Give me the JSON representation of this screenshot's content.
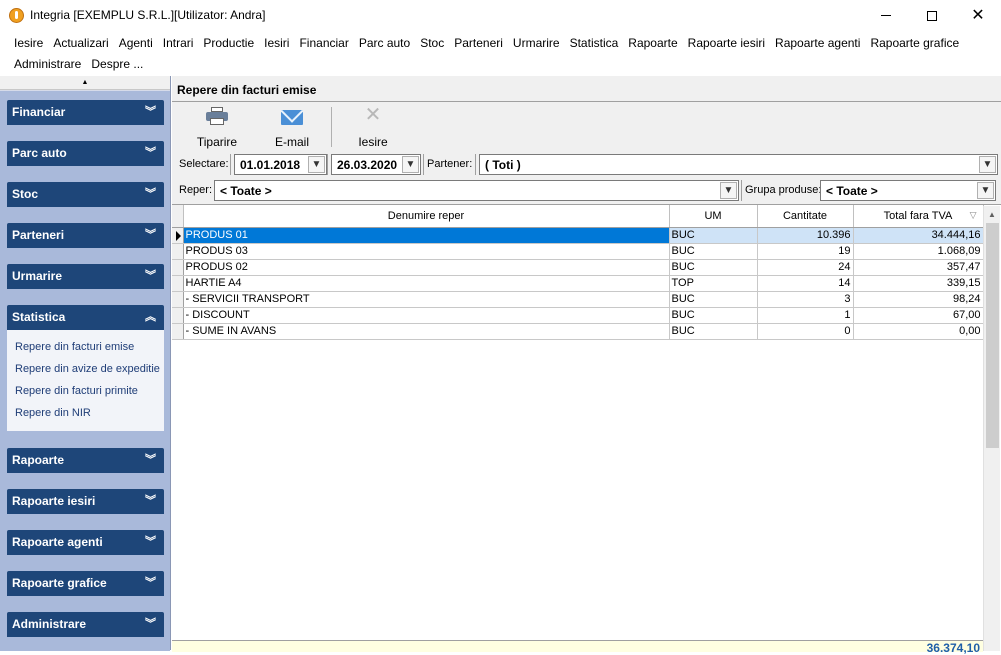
{
  "window": {
    "title": "Integria [EXEMPLU S.R.L.][Utilizator: Andra]"
  },
  "menu": [
    "Iesire",
    "Actualizari",
    "Agenti",
    "Intrari",
    "Productie",
    "Iesiri",
    "Financiar",
    "Parc auto",
    "Stoc",
    "Parteneri",
    "Urmarire",
    "Statistica",
    "Rapoarte",
    "Rapoarte iesiri",
    "Rapoarte agenti",
    "Rapoarte grafice",
    "Administrare",
    "Despre ..."
  ],
  "sidebar": {
    "groups": [
      "Financiar",
      "Parc auto",
      "Stoc",
      "Parteneri",
      "Urmarire",
      "Statistica",
      "Rapoarte",
      "Rapoarte iesiri",
      "Rapoarte agenti",
      "Rapoarte grafice",
      "Administrare"
    ],
    "expanded_group": "Statistica",
    "expanded_items": [
      "Repere din facturi emise",
      "Repere din avize de expeditie",
      "Repere din facturi primite",
      "Repere din NIR"
    ]
  },
  "panel": {
    "title": "Repere din facturi emise",
    "toolbar": {
      "print_label": "Tiparire",
      "email_label": "E-mail",
      "exit_label": "Iesire"
    },
    "filters": {
      "selectare_label": "Selectare:",
      "date_from": "01.01.2018",
      "date_to": "26.03.2020",
      "partener_label": "Partener:",
      "partener_value": "( Toti )",
      "reper_label": "Reper:",
      "reper_value": "< Toate >",
      "grupa_label": "Grupa produse:",
      "grupa_value": "< Toate >"
    },
    "grid": {
      "columns": [
        "Denumire reper",
        "UM",
        "Cantitate",
        "Total fara TVA"
      ],
      "rows": [
        {
          "name": "PRODUS 01",
          "um": "BUC",
          "qty": "10.396",
          "total": "34.444,16"
        },
        {
          "name": "PRODUS 03",
          "um": "BUC",
          "qty": "19",
          "total": "1.068,09"
        },
        {
          "name": "PRODUS 02",
          "um": "BUC",
          "qty": "24",
          "total": "357,47"
        },
        {
          "name": "HARTIE A4",
          "um": "TOP",
          "qty": "14",
          "total": "339,15"
        },
        {
          "name": "- SERVICII TRANSPORT",
          "um": "BUC",
          "qty": "3",
          "total": "98,24"
        },
        {
          "name": "- DISCOUNT",
          "um": "BUC",
          "qty": "1",
          "total": "67,00"
        },
        {
          "name": "- SUME IN AVANS",
          "um": "BUC",
          "qty": "0",
          "total": "0,00"
        }
      ],
      "selected_row": 0,
      "footer_total": "36.374,10"
    }
  },
  "colors": {
    "sidebar_group_bg": "#1e4679",
    "sidebar_bg": "#a9b9da",
    "selection": "#0078d7",
    "footer_bg": "#ffffe1"
  }
}
